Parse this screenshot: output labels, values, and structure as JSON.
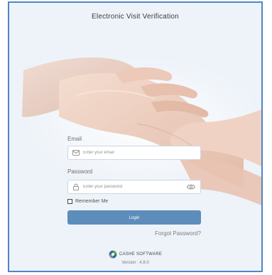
{
  "app": {
    "title": "Electronic Visit Verification"
  },
  "form": {
    "email_label": "Email",
    "email_placeholder": "Enter your email",
    "password_label": "Password",
    "password_placeholder": "Enter your password",
    "remember_label": "Remember Me",
    "login_label": "Login",
    "forgot_label": "Forgot Password?"
  },
  "footer": {
    "brand_name": "CASHE SOFTWARE",
    "version": "Version : 4.8.0"
  },
  "colors": {
    "frame": "#4f86c6",
    "background": "#eef3f9",
    "button": "#5c8dbb",
    "brand_blue": "#2f6ea8",
    "brand_green": "#5ea84a",
    "brand_gray": "#8a8a8a"
  },
  "icons": {
    "email": "envelope-icon",
    "password": "lock-icon",
    "show_password": "eye-icon",
    "brand": "cashe-logo-icon"
  }
}
